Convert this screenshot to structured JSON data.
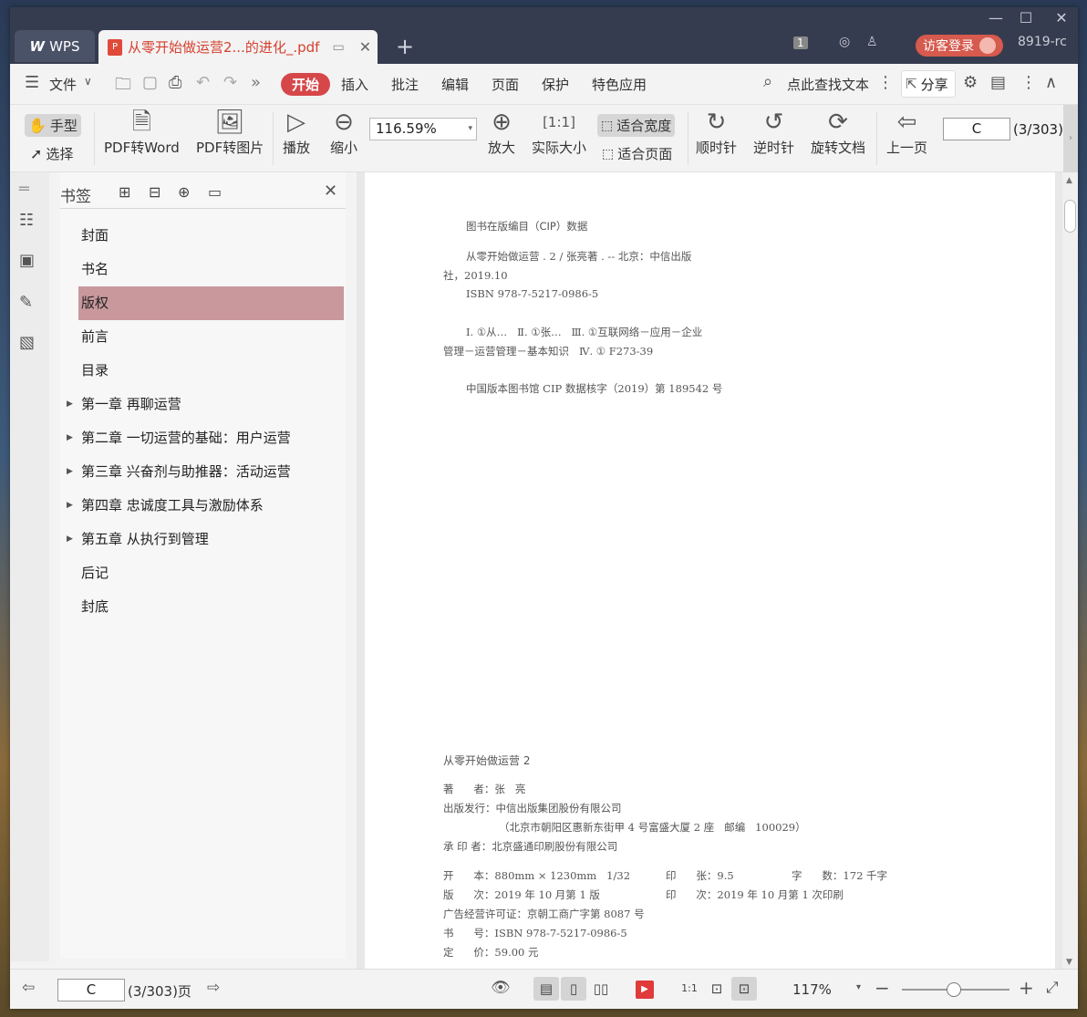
{
  "titlebar": {
    "wps_tab": "WPS",
    "doc_tab": "从零开始做运营2...的进化_.pdf",
    "badge": "1",
    "login": "访客登录",
    "user": "8919-rc"
  },
  "menu": {
    "file": "文件",
    "start": "开始",
    "items": [
      "插入",
      "批注",
      "编辑",
      "页面",
      "保护",
      "特色应用"
    ],
    "search": "点此查找文本",
    "share": "分享"
  },
  "toolbar": {
    "hand": "手型",
    "select": "选择",
    "pdf_word": "PDF转Word",
    "pdf_image": "PDF转图片",
    "play": "播放",
    "zoom_out": "缩小",
    "zoom_value": "116.59%",
    "zoom_in": "放大",
    "actual": "实际大小",
    "fit_width": "适合宽度",
    "fit_page": "适合页面",
    "cw": "顺时针",
    "ccw": "逆时针",
    "rotate": "旋转文档",
    "prev": "上一页",
    "page_input": "C",
    "page_total": "(3/303)"
  },
  "bookmarks": {
    "title": "书签",
    "items": [
      {
        "label": "封面",
        "expandable": false,
        "selected": false
      },
      {
        "label": "书名",
        "expandable": false,
        "selected": false
      },
      {
        "label": "版权",
        "expandable": false,
        "selected": true
      },
      {
        "label": "前言",
        "expandable": false,
        "selected": false
      },
      {
        "label": "目录",
        "expandable": false,
        "selected": false
      },
      {
        "label": "第一章 再聊运营",
        "expandable": true,
        "selected": false
      },
      {
        "label": "第二章 一切运营的基础：用户运营",
        "expandable": true,
        "selected": false
      },
      {
        "label": "第三章 兴奋剂与助推器：活动运营",
        "expandable": true,
        "selected": false
      },
      {
        "label": "第四章 忠诚度工具与激励体系",
        "expandable": true,
        "selected": false
      },
      {
        "label": "第五章 从执行到管理",
        "expandable": true,
        "selected": false
      },
      {
        "label": "后记",
        "expandable": false,
        "selected": false
      },
      {
        "label": "封底",
        "expandable": false,
        "selected": false
      }
    ]
  },
  "page": {
    "cip_title": "图书在版编目（CIP）数据",
    "cip1": "从零开始做运营 . 2 / 张亮著 . -- 北京：中信出版",
    "cip2": "社，2019.10",
    "cip3": "ISBN 978-7-5217-0986-5",
    "cip4": "Ⅰ. ①从…   Ⅱ. ①张…   Ⅲ. ①互联网络－应用－企业",
    "cip5": "管理－运营管理－基本知识   Ⅳ. ① F273-39",
    "cip6": "中国版本图书馆 CIP 数据核字（2019）第 189542 号",
    "book": "从零开始做运营 2",
    "author": "著      者：张   亮",
    "publisher": "出版发行：中信出版集团股份有限公司",
    "address": "（北京市朝阳区惠新东街甲 4 号富盛大厦 2 座   邮编   100029）",
    "printer": "承 印 者：北京盛通印刷股份有限公司",
    "format": "开      本：880mm × 1230mm   1/32",
    "sheets": "印      张：9.5",
    "words": "字      数：172 千字",
    "edition": "版      次：2019 年 10 月第 1 版",
    "printing": "印      次：2019 年 10 月第 1 次印刷",
    "license": "广告经营许可证：京朝工商广字第 8087 号",
    "isbn": "书      号：ISBN 978-7-5217-0986-5",
    "price": "定      价：59.00 元"
  },
  "status": {
    "page_input": "C",
    "page_label": "(3/303)页",
    "zoom": "117%"
  }
}
